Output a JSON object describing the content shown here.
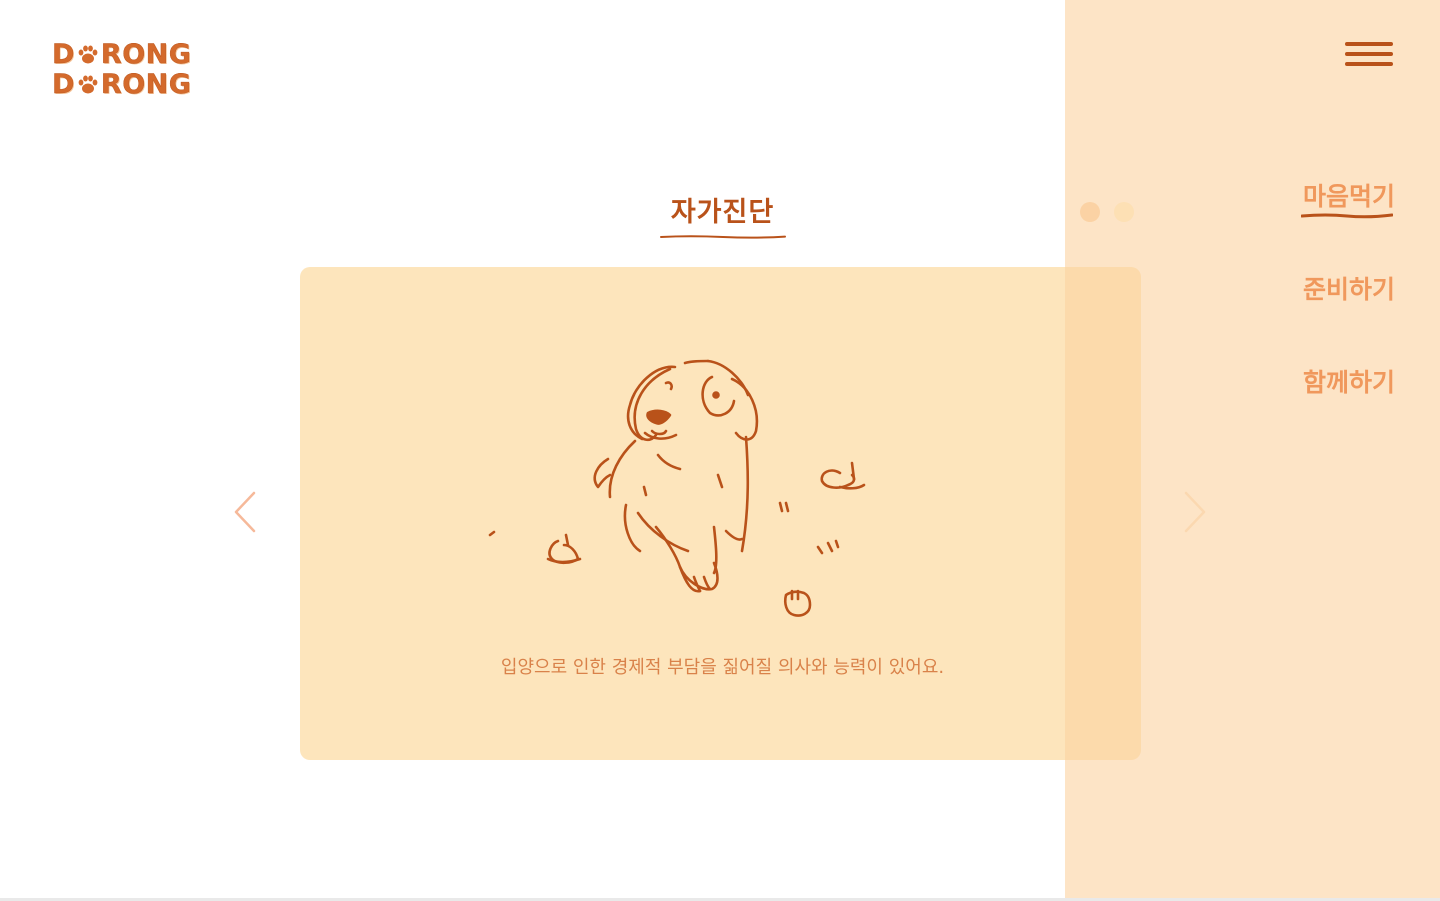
{
  "brand": {
    "logo_line1_prefix": "D",
    "logo_line1_suffix": "RONG",
    "logo_line2_prefix": "D",
    "logo_line2_suffix": "RONG",
    "accent_color": "#d46a2c"
  },
  "main": {
    "title": "자가진단",
    "caption": "입양으로 인한 경제적 부담을 짊어질 의사와 능력이 있어요.",
    "card_color": "#fde5bc"
  },
  "carousel": {
    "prev_icon": "chevron-left-icon",
    "next_icon": "chevron-right-icon",
    "pagination_count": 2,
    "active_index": 1
  },
  "sidebar": {
    "menu_icon": "hamburger-menu-icon",
    "items": [
      {
        "label": "마음먹기",
        "active": true
      },
      {
        "label": "준비하기",
        "active": false
      },
      {
        "label": "함께하기",
        "active": false
      }
    ],
    "panel_color": "#fce1bf"
  }
}
